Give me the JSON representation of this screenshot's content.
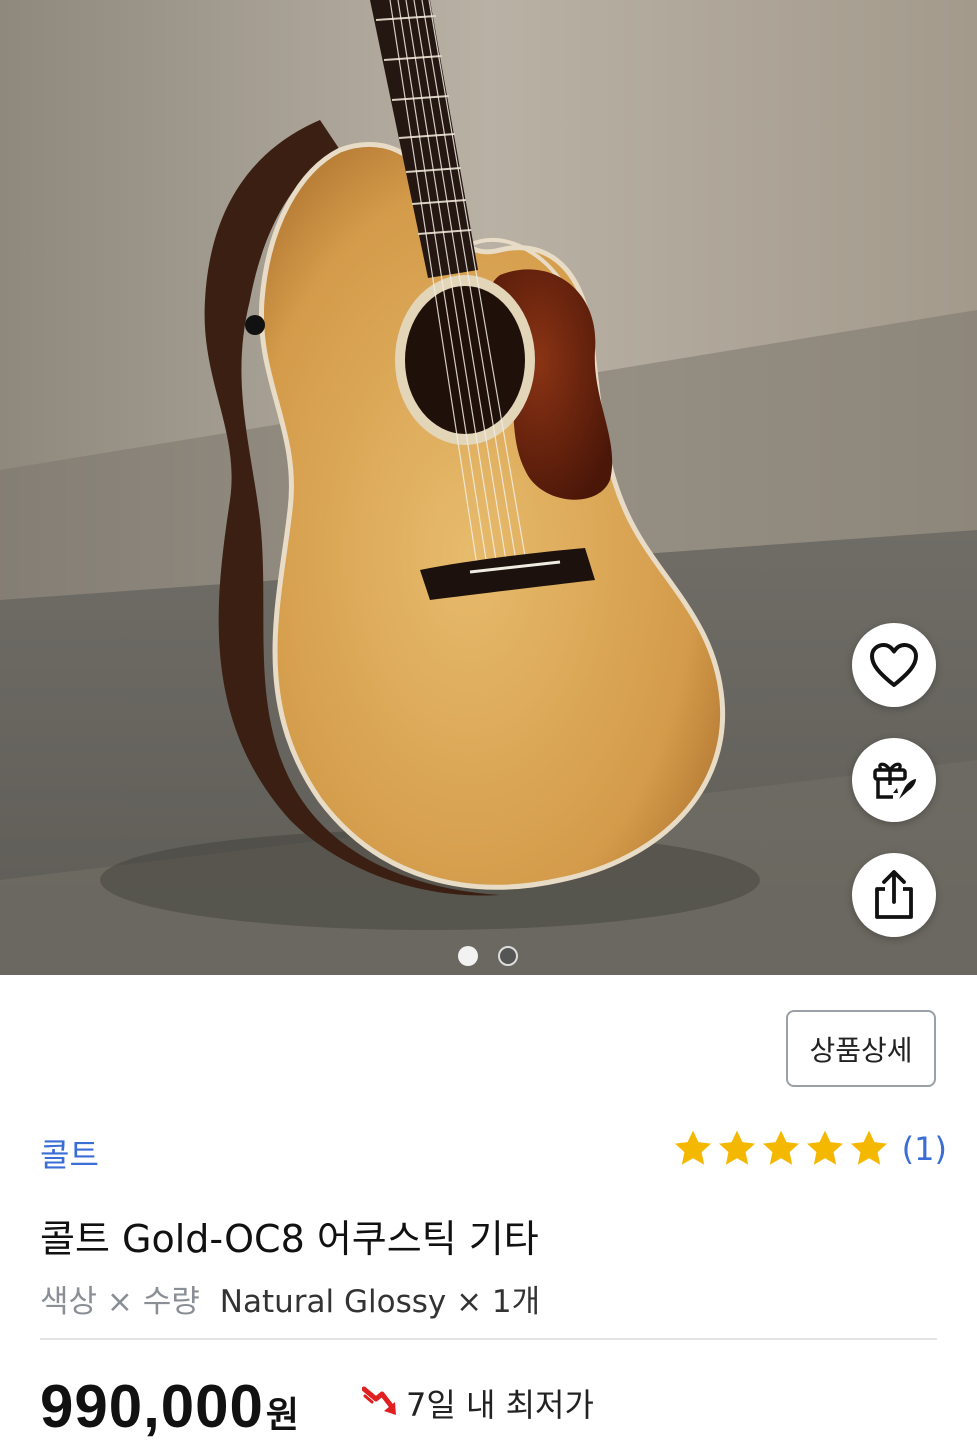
{
  "hero": {
    "image_alt": "콜트 Gold-OC8 어쿠스틱 기타",
    "pagination": {
      "total": 2,
      "current": 1
    }
  },
  "actions": [
    {
      "name": "wishlist",
      "icon": "heart-icon"
    },
    {
      "name": "gift",
      "icon": "gift-rocket-icon"
    },
    {
      "name": "share",
      "icon": "share-icon"
    }
  ],
  "product": {
    "detail_button": "상품상세",
    "brand": "콜트",
    "rating": {
      "stars": 5,
      "count_label": "(1)",
      "star_color": "#f5b800"
    },
    "title": "콜트 Gold-OC8 어쿠스틱 기타",
    "option_label": "색상 × 수량",
    "option_value": "Natural Glossy × 1개",
    "price": "990,000",
    "price_unit": "원",
    "lowest_badge": "7일 내 최저가",
    "lowest_icon": "down-trend-arrow-icon",
    "lowest_icon_color": "#e02020"
  }
}
